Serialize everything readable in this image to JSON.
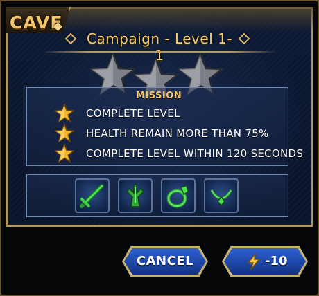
{
  "header": {
    "tab_label": "CAVE",
    "title": "Campaign - Level 1-1"
  },
  "rating": {
    "stars_earned": 0,
    "stars_total": 3
  },
  "mission": {
    "label": "MISSION",
    "objectives": [
      "COMPLETE LEVEL",
      "HEALTH REMAIN MORE THAN 75%",
      "COMPLETE LEVEL WITHIN 120 SECONDS"
    ]
  },
  "rewards": {
    "items": [
      {
        "icon": "green-sword-icon"
      },
      {
        "icon": "green-tree-armor-icon"
      },
      {
        "icon": "green-ring-icon"
      },
      {
        "icon": "green-necklace-icon"
      }
    ]
  },
  "buttons": {
    "cancel_label": "CANCEL",
    "start_cost": "-10",
    "start_cost_icon": "energy-bolt-icon"
  },
  "colors": {
    "gold": "#f2c46b",
    "panel_bg": "#0d1a34",
    "button_blue": "#1e47a8",
    "item_green": "#3fe04a"
  }
}
